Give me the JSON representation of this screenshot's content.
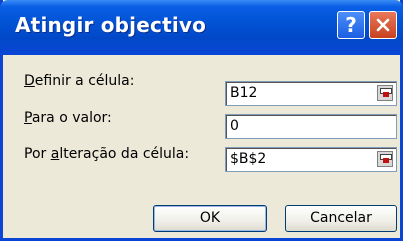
{
  "window": {
    "title": "Atingir objectivo"
  },
  "titlebar": {
    "help_glyph": "?",
    "help_icon": "help-icon",
    "close_icon": "close-icon"
  },
  "fields": [
    {
      "label_pre": "",
      "label_key": "D",
      "label_post": "efinir a célula:",
      "value": "B12",
      "has_ref_button": true
    },
    {
      "label_pre": "",
      "label_key": "P",
      "label_post": "ara o valor:",
      "value": "0",
      "has_ref_button": false
    },
    {
      "label_pre": "Por ",
      "label_key": "a",
      "label_post": "lteração da célula:",
      "value": "$B$2",
      "has_ref_button": true
    }
  ],
  "buttons": {
    "ok": "OK",
    "cancel": "Cancelar"
  },
  "colors": {
    "titlebar": "#0355d8",
    "frame": "#0a45d6",
    "face": "#ece9d8",
    "close": "#c7421f"
  }
}
